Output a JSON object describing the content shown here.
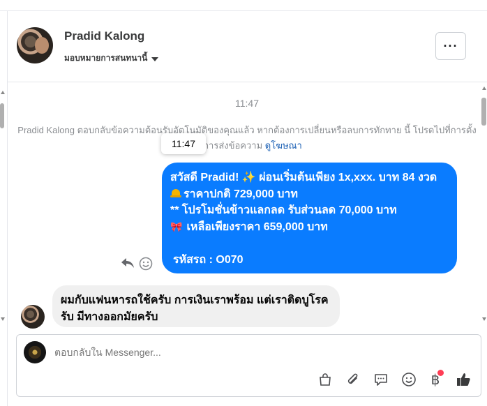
{
  "header": {
    "contact_name": "Pradid Kalong",
    "assign_label": "มอบหมายการสนทนานี้",
    "more_label": "···"
  },
  "chat": {
    "timestamp": "11:47",
    "system_message": "Pradid Kalong ตอบกลับข้อความต้อนรับอัตโนมัติของคุณแล้ว หากต้องการเปลี่ยนหรือลบการทักทาย นี้ โปรดไปที่การตั้งค่าการส่งข้อความ",
    "system_message_link": "ดูโฆษณา",
    "tooltip_time": "11:47",
    "outgoing": {
      "line1": "สวัสดี Pradid!",
      "line1_sparkle": "✨",
      "line1_rest": "ผ่อนเริ่มต้นเพียง 1x,xxx. บาท 84 งวด",
      "line2": "ราคาปกติ 729,000 บาท",
      "line3": "** โปรโมชั่นข้าวแลกลด รับส่วนลด 70,000 บาท",
      "line4": "เหลือเพียงราคา 659,000 บาท",
      "line5": "รหัสรถ : O070"
    },
    "incoming": {
      "text": "ผมกับแฟนหารถใช้ครับ การเงินเราพร้อม แต่เราติดบูโรครับ มีทางออกมัยครับ"
    }
  },
  "composer": {
    "placeholder": "ตอบกลับใน Messenger...",
    "currency_symbol": "฿"
  },
  "colors": {
    "outgoing_bubble": "#0a7cff",
    "incoming_bubble": "#f0f0f0",
    "link": "#1a5fb4",
    "notification_dot": "#ff3d55"
  },
  "icons": [
    "chevron-down-icon",
    "more-icon",
    "reply-icon",
    "emoji-icon",
    "shop-bag-icon",
    "paperclip-icon",
    "chat-bubble-icon",
    "smile-icon",
    "baht-icon",
    "thumbs-up-icon"
  ]
}
